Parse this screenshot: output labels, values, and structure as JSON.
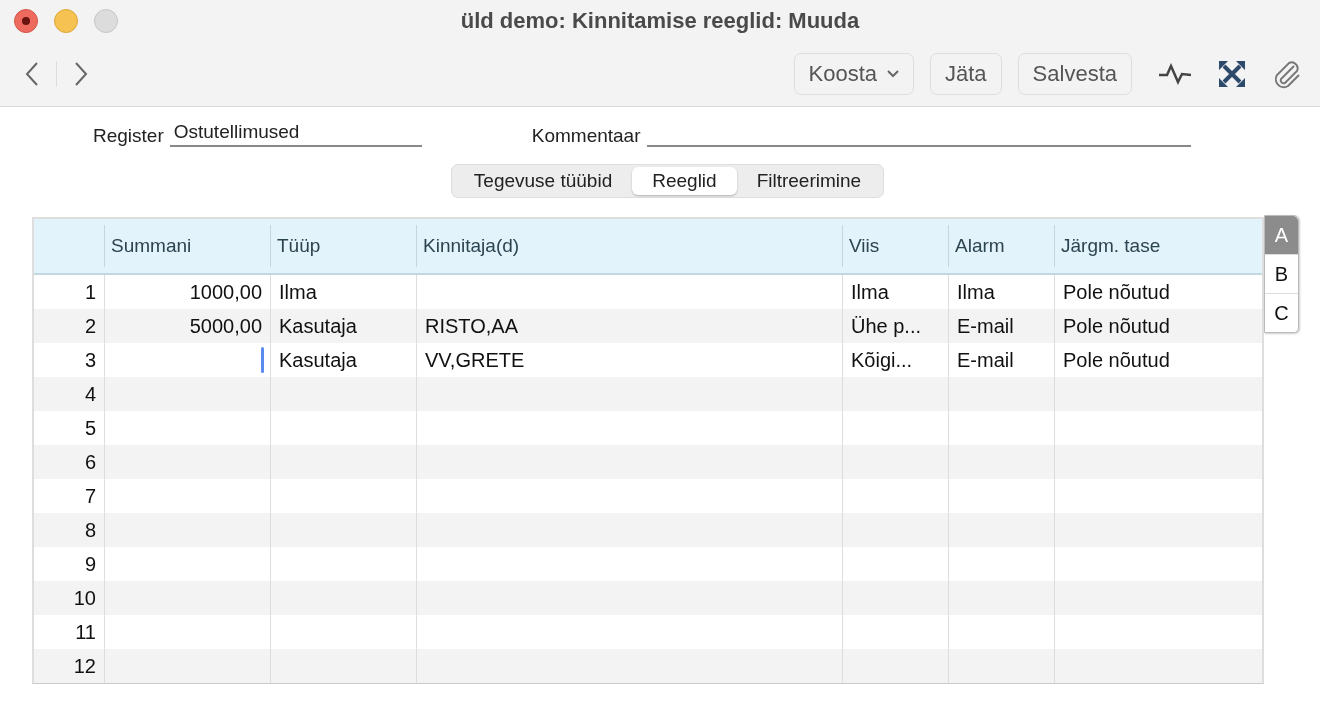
{
  "window": {
    "title": "üld demo: Kinnitamise reeglid: Muuda"
  },
  "toolbar": {
    "buttons": [
      {
        "label": "Koosta",
        "kind": "menu"
      },
      {
        "label": "Jäta",
        "kind": "plain"
      },
      {
        "label": "Salvesta",
        "kind": "plain"
      }
    ]
  },
  "form": {
    "register_label": "Register",
    "register_value": "Ostutellimused",
    "comment_label": "Kommentaar"
  },
  "tabs": [
    {
      "label": "Tegevuse tüübid",
      "selected": false
    },
    {
      "label": "Reeglid",
      "selected": true
    },
    {
      "label": "Filtreerimine",
      "selected": false
    }
  ],
  "table": {
    "columns": [
      "Summani",
      "Tüüp",
      "Kinnitaja(d)",
      "Viis",
      "Alarm",
      "Järgm. tase"
    ],
    "rows": [
      {
        "number": "1",
        "cells": [
          "1000,00",
          "Ilma",
          "",
          "Ilma",
          "Ilma",
          "Pole nõutud"
        ],
        "editing": false
      },
      {
        "number": "2",
        "cells": [
          "5000,00",
          "Kasutaja",
          "RISTO,AA",
          "Ühe p...",
          "E-mail",
          "Pole nõutud"
        ],
        "editing": false
      },
      {
        "number": "3",
        "cells": [
          "",
          "Kasutaja",
          "VV,GRETE",
          "Kõigi...",
          "E-mail",
          "Pole nõutud"
        ],
        "editing": true
      },
      {
        "number": "4",
        "editing": false
      },
      {
        "number": "5",
        "editing": false
      },
      {
        "number": "6",
        "editing": false
      },
      {
        "number": "7",
        "editing": false
      },
      {
        "number": "8",
        "editing": false
      },
      {
        "number": "9",
        "editing": false
      },
      {
        "number": "10",
        "editing": false
      },
      {
        "number": "11",
        "editing": false
      },
      {
        "number": "12",
        "editing": false
      }
    ]
  },
  "side_tabs": [
    {
      "label": "A",
      "selected": true
    },
    {
      "label": "B",
      "selected": false
    },
    {
      "label": "C",
      "selected": false
    }
  ]
}
